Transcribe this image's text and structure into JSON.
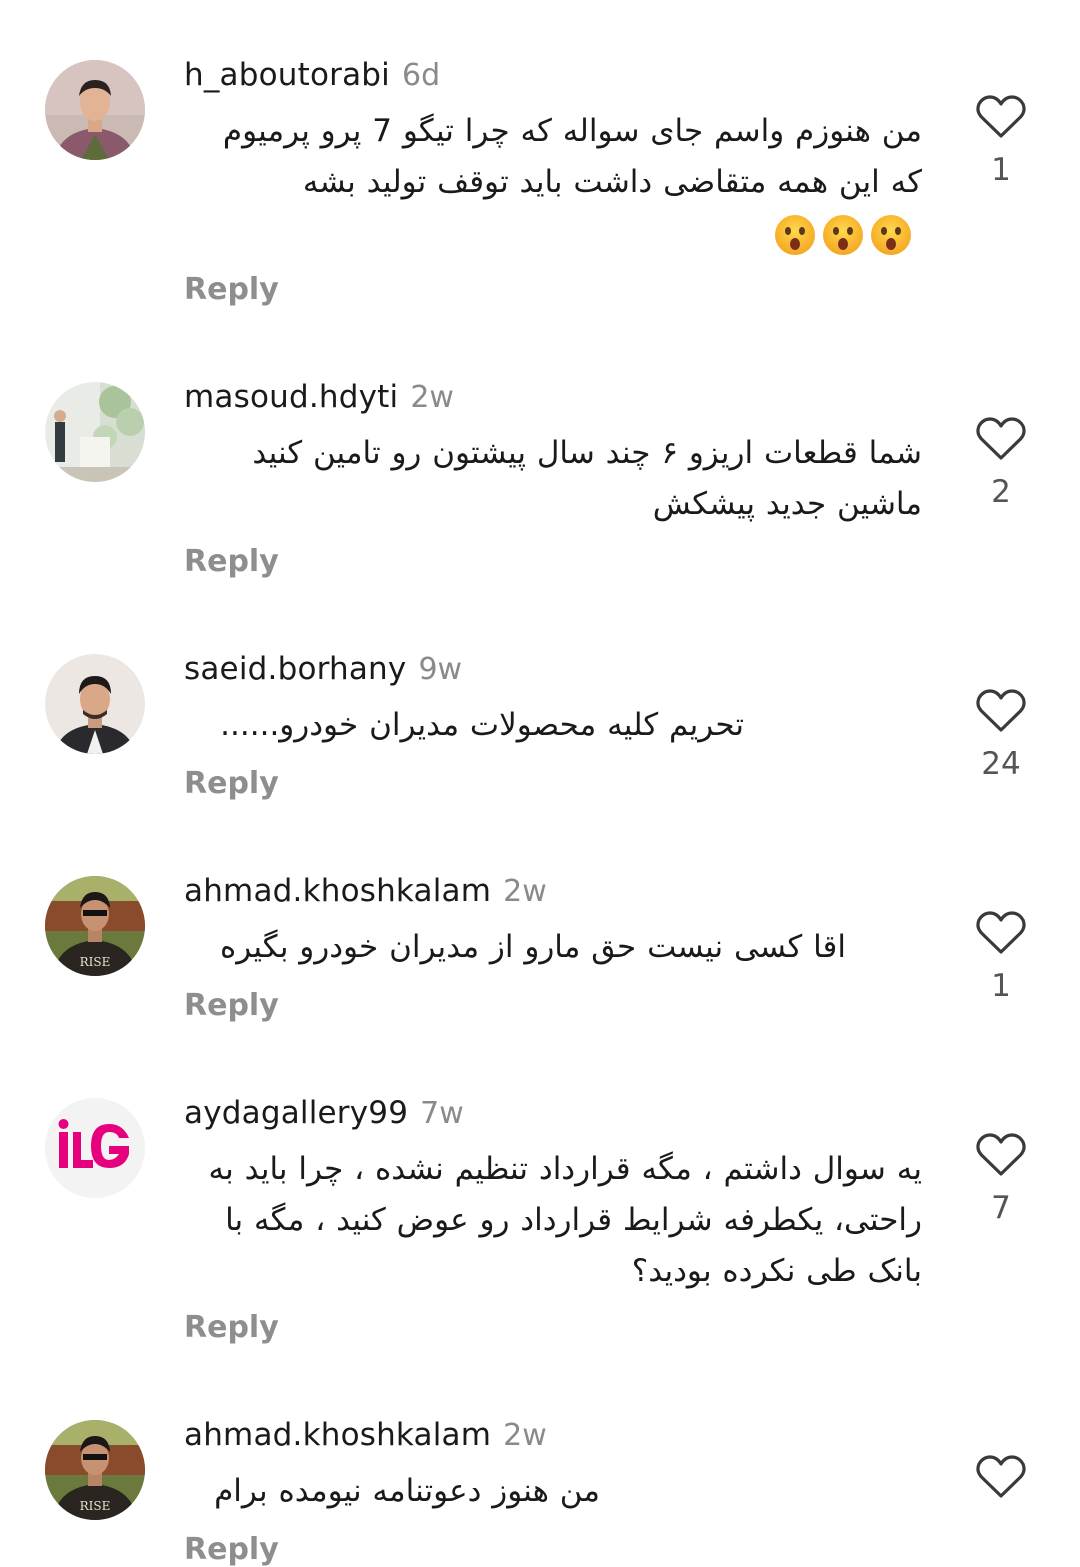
{
  "comments": [
    {
      "username": "h_aboutorabi",
      "time": "6d",
      "text": "من هنوزم واسم جای سواله که چرا تیگو 7 پرو پرمیوم که این همه متقاضی داشت باید توقف تولید بشه",
      "emojis": [
        "hushed-face-emoji",
        "hushed-face-emoji",
        "hushed-face-emoji"
      ],
      "reply_label": "Reply",
      "likes": "1"
    },
    {
      "username": "masoud.hdyti",
      "time": "2w",
      "text": "شما قطعات اریزو ۶ چند سال پیشتون رو تامین کنید ماشین جدید پیشکش",
      "reply_label": "Reply",
      "likes": "2"
    },
    {
      "username": "saeid.borhany",
      "time": "9w",
      "text": "تحریم کلیه محصولات مدیران خودرو......",
      "reply_label": "Reply",
      "likes": "24"
    },
    {
      "username": "ahmad.khoshkalam",
      "time": "2w",
      "text": "اقا کسی نیست حق مارو از مدیران خودرو بگیره",
      "reply_label": "Reply",
      "likes": "1"
    },
    {
      "username": "aydagallery99",
      "time": "7w",
      "text": "یه سوال داشتم ، مگه قرارداد تنظیم نشده ، چرا باید به راحتی، یکطرفه شرایط قرارداد رو عوض کنید ، مگه با بانک طی نکرده بودید؟",
      "reply_label": "Reply",
      "likes": "7"
    },
    {
      "username": "ahmad.khoshkalam",
      "time": "2w",
      "text": "من هنوز دعوتنامه نیومده برام",
      "reply_label": "Reply",
      "likes": ""
    }
  ],
  "colors": {
    "username": "#1a1a1a",
    "meta": "#8e8e8e",
    "like_outline": "#3a3a3a",
    "logo_pink": "#e6007e"
  }
}
